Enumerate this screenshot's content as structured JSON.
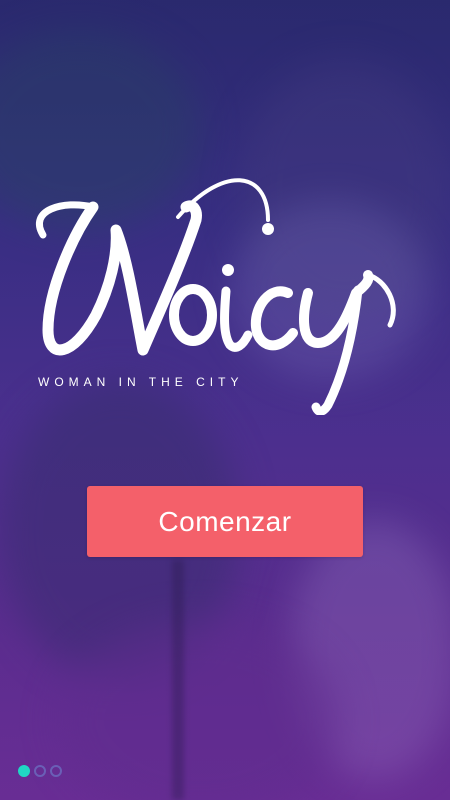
{
  "brand": {
    "logo_text": "Woicy",
    "tagline": "WOMAN IN THE CITY"
  },
  "actions": {
    "start_label": "Comenzar"
  },
  "pagination": {
    "total": 3,
    "active": 1
  },
  "colors": {
    "button": "#f4606a",
    "dot_active": "#20d6c4",
    "dot_inactive": "#6a5fb6",
    "text": "#ffffff"
  }
}
